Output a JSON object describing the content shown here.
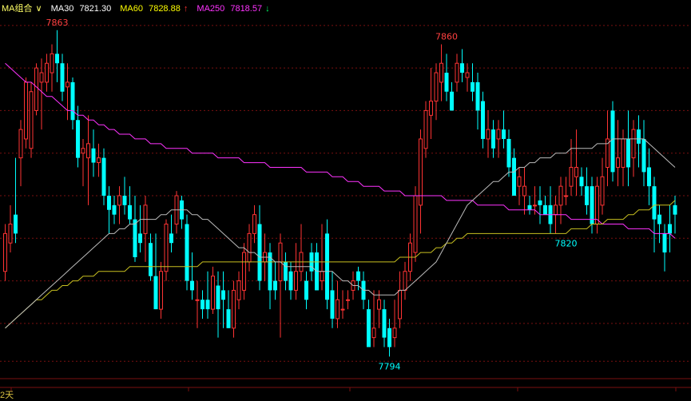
{
  "legend": {
    "group_label": "MA组合",
    "group_arrow": "∨",
    "ma30": {
      "label": "MA30",
      "value": "7821.30",
      "color": "#ffffff"
    },
    "ma60": {
      "label": "MA60",
      "value": "7828.88",
      "arrow": "↑",
      "color": "#ffff00"
    },
    "ma250": {
      "label": "MA250",
      "value": "7818.57",
      "arrow": "↓",
      "color": "#ff33ff"
    }
  },
  "footer_text": "2天",
  "colors": {
    "up": "#ff3333",
    "down": "#00ffff",
    "grid": "#7a1010",
    "background": "#000000"
  },
  "chart_data": {
    "type": "candlestick",
    "ylim": [
      7790,
      7866
    ],
    "grid_levels": [
      7864,
      7855,
      7846,
      7837,
      7828,
      7819,
      7810,
      7801,
      7793
    ],
    "annotations": [
      {
        "text": "7863",
        "index": 10,
        "value": 7863,
        "color": "#ff4040"
      },
      {
        "text": "7860",
        "index": 85,
        "value": 7860,
        "color": "#ff4040"
      },
      {
        "text": "7820",
        "index": 108,
        "value": 7820,
        "color": "#00ffff"
      },
      {
        "text": "7794",
        "index": 74,
        "value": 7794,
        "color": "#00ffff"
      }
    ],
    "candles": [
      [
        7812,
        7820,
        7810,
        7822
      ],
      [
        7818,
        7822,
        7816,
        7826
      ],
      [
        7824,
        7820,
        7818,
        7836
      ],
      [
        7836,
        7842,
        7830,
        7844
      ],
      [
        7840,
        7852,
        7838,
        7853
      ],
      [
        7838,
        7850,
        7836,
        7852
      ],
      [
        7846,
        7855,
        7845,
        7856
      ],
      [
        7852,
        7854,
        7842,
        7857
      ],
      [
        7852,
        7856,
        7850,
        7858
      ],
      [
        7854,
        7858,
        7850,
        7860
      ],
      [
        7858,
        7856,
        7852,
        7863
      ],
      [
        7856,
        7850,
        7848,
        7858
      ],
      [
        7851,
        7852,
        7844,
        7856
      ],
      [
        7852,
        7844,
        7842,
        7853
      ],
      [
        7844,
        7836,
        7834,
        7847
      ],
      [
        7837,
        7838,
        7830,
        7840
      ],
      [
        7836,
        7839,
        7826,
        7845
      ],
      [
        7838,
        7835,
        7832,
        7842
      ],
      [
        7835,
        7836,
        7832,
        7839
      ],
      [
        7836,
        7828,
        7826,
        7838
      ],
      [
        7828,
        7825,
        7820,
        7830
      ],
      [
        7826,
        7824,
        7822,
        7828
      ],
      [
        7826,
        7828,
        7822,
        7830
      ],
      [
        7828,
        7826,
        7824,
        7832
      ],
      [
        7826,
        7823,
        7822,
        7830
      ],
      [
        7823,
        7815,
        7814,
        7828
      ],
      [
        7820,
        7818,
        7816,
        7826
      ],
      [
        7820,
        7826,
        7814,
        7828
      ],
      [
        7818,
        7811,
        7810,
        7820
      ],
      [
        7811,
        7804,
        7804,
        7820
      ],
      [
        7804,
        7812,
        7802,
        7814
      ],
      [
        7812,
        7822,
        7810,
        7823
      ],
      [
        7820,
        7818,
        7816,
        7824
      ],
      [
        7822,
        7828,
        7820,
        7829
      ],
      [
        7827,
        7823,
        7821,
        7828
      ],
      [
        7822,
        7810,
        7808,
        7824
      ],
      [
        7810,
        7808,
        7806,
        7816
      ],
      [
        7806,
        7806,
        7800,
        7810
      ],
      [
        7806,
        7804,
        7802,
        7808
      ],
      [
        7806,
        7804,
        7802,
        7812
      ],
      [
        7804,
        7811,
        7803,
        7813
      ],
      [
        7809,
        7804,
        7798,
        7812
      ],
      [
        7808,
        7806,
        7800,
        7812
      ],
      [
        7804,
        7800,
        7800,
        7808
      ],
      [
        7800,
        7808,
        7798,
        7810
      ],
      [
        7806,
        7810,
        7804,
        7812
      ],
      [
        7808,
        7816,
        7806,
        7818
      ],
      [
        7814,
        7820,
        7812,
        7822
      ],
      [
        7820,
        7824,
        7818,
        7826
      ],
      [
        7822,
        7810,
        7808,
        7826
      ],
      [
        7814,
        7816,
        7810,
        7820
      ],
      [
        7816,
        7808,
        7804,
        7818
      ],
      [
        7810,
        7808,
        7806,
        7814
      ],
      [
        7810,
        7818,
        7798,
        7820
      ],
      [
        7814,
        7810,
        7808,
        7816
      ],
      [
        7812,
        7808,
        7806,
        7814
      ],
      [
        7808,
        7812,
        7806,
        7818
      ],
      [
        7812,
        7816,
        7810,
        7822
      ],
      [
        7810,
        7806,
        7804,
        7812
      ],
      [
        7816,
        7812,
        7810,
        7818
      ],
      [
        7816,
        7808,
        7808,
        7818
      ],
      [
        7810,
        7812,
        7808,
        7822
      ],
      [
        7820,
        7806,
        7804,
        7823
      ],
      [
        7808,
        7802,
        7800,
        7812
      ],
      [
        7802,
        7806,
        7800,
        7810
      ],
      [
        7804,
        7804,
        7802,
        7808
      ],
      [
        7806,
        7806,
        7804,
        7808
      ],
      [
        7808,
        7810,
        7806,
        7812
      ],
      [
        7812,
        7810,
        7808,
        7813
      ],
      [
        7810,
        7806,
        7804,
        7812
      ],
      [
        7804,
        7796,
        7796,
        7806
      ],
      [
        7798,
        7800,
        7796,
        7808
      ],
      [
        7804,
        7806,
        7800,
        7808
      ],
      [
        7804,
        7798,
        7796,
        7806
      ],
      [
        7800,
        7796,
        7794,
        7802
      ],
      [
        7798,
        7800,
        7796,
        7806
      ],
      [
        7802,
        7808,
        7800,
        7812
      ],
      [
        7808,
        7812,
        7806,
        7814
      ],
      [
        7812,
        7818,
        7810,
        7820
      ],
      [
        7816,
        7828,
        7814,
        7830
      ],
      [
        7826,
        7840,
        7820,
        7842
      ],
      [
        7838,
        7846,
        7836,
        7848
      ],
      [
        7845,
        7848,
        7840,
        7855
      ],
      [
        7848,
        7854,
        7844,
        7856
      ],
      [
        7852,
        7856,
        7848,
        7860
      ],
      [
        7854,
        7850,
        7848,
        7858
      ],
      [
        7850,
        7846,
        7846,
        7852
      ],
      [
        7852,
        7856,
        7850,
        7858
      ],
      [
        7856,
        7854,
        7852,
        7859
      ],
      [
        7853,
        7854,
        7850,
        7856
      ],
      [
        7852,
        7850,
        7848,
        7856
      ],
      [
        7852,
        7846,
        7842,
        7854
      ],
      [
        7848,
        7840,
        7838,
        7850
      ],
      [
        7840,
        7842,
        7836,
        7846
      ],
      [
        7842,
        7838,
        7836,
        7844
      ],
      [
        7840,
        7842,
        7836,
        7844
      ],
      [
        7842,
        7840,
        7838,
        7846
      ],
      [
        7840,
        7834,
        7832,
        7842
      ],
      [
        7836,
        7828,
        7828,
        7838
      ],
      [
        7830,
        7832,
        7826,
        7834
      ],
      [
        7828,
        7830,
        7824,
        7834
      ],
      [
        7826,
        7825,
        7824,
        7828
      ],
      [
        7826,
        7826,
        7824,
        7830
      ],
      [
        7827,
        7826,
        7822,
        7830
      ],
      [
        7826,
        7824,
        7824,
        7828
      ],
      [
        7826,
        7822,
        7820,
        7830
      ],
      [
        7824,
        7826,
        7820,
        7828
      ],
      [
        7826,
        7830,
        7822,
        7832
      ],
      [
        7828,
        7828,
        7826,
        7832
      ],
      [
        7830,
        7834,
        7828,
        7840
      ],
      [
        7832,
        7834,
        7828,
        7842
      ],
      [
        7832,
        7830,
        7828,
        7834
      ],
      [
        7830,
        7826,
        7824,
        7834
      ],
      [
        7830,
        7822,
        7820,
        7832
      ],
      [
        7822,
        7830,
        7820,
        7832
      ],
      [
        7826,
        7832,
        7824,
        7836
      ],
      [
        7834,
        7840,
        7830,
        7846
      ],
      [
        7846,
        7833,
        7831,
        7848
      ],
      [
        7834,
        7836,
        7830,
        7844
      ],
      [
        7834,
        7840,
        7830,
        7842
      ],
      [
        7840,
        7834,
        7830,
        7846
      ],
      [
        7836,
        7842,
        7832,
        7844
      ],
      [
        7842,
        7839,
        7834,
        7845
      ],
      [
        7840,
        7833,
        7830,
        7844
      ],
      [
        7834,
        7830,
        7826,
        7838
      ],
      [
        7830,
        7823,
        7816,
        7832
      ],
      [
        7824,
        7822,
        7818,
        7826
      ],
      [
        7820,
        7816,
        7812,
        7822
      ],
      [
        7822,
        7820,
        7816,
        7826
      ],
      [
        7826,
        7824,
        7820,
        7828
      ]
    ],
    "ma30": [
      7800,
      7801,
      7802,
      7803,
      7804,
      7805,
      7806,
      7807,
      7808,
      7809,
      7810,
      7811,
      7812,
      7813,
      7814,
      7815,
      7816,
      7817,
      7818,
      7819,
      7820,
      7820,
      7821,
      7821,
      7822,
      7822,
      7823,
      7823,
      7823,
      7823,
      7824,
      7824,
      7825,
      7825,
      7825,
      7825,
      7824,
      7824,
      7823,
      7823,
      7822,
      7821,
      7820,
      7819,
      7818,
      7817,
      7817,
      7816,
      7816,
      7815,
      7815,
      7815,
      7814,
      7814,
      7813,
      7813,
      7813,
      7813,
      7813,
      7813,
      7812,
      7812,
      7812,
      7812,
      7811,
      7810,
      7810,
      7809,
      7809,
      7808,
      7808,
      7807,
      7807,
      7807,
      7807,
      7807,
      7808,
      7808,
      7809,
      7810,
      7811,
      7812,
      7813,
      7814,
      7816,
      7818,
      7820,
      7822,
      7824,
      7826,
      7827,
      7828,
      7829,
      7830,
      7831,
      7831,
      7832,
      7833,
      7833,
      7834,
      7834,
      7835,
      7835,
      7836,
      7836,
      7836,
      7837,
      7837,
      7837,
      7838,
      7838,
      7838,
      7838,
      7838,
      7839,
      7839,
      7839,
      7840,
      7840,
      7840,
      7840,
      7840,
      7840,
      7840,
      7839,
      7838,
      7837,
      7836,
      7835,
      7834
    ],
    "ma60": [
      7800,
      7801,
      7802,
      7803,
      7804,
      7805,
      7806,
      7806,
      7807,
      7808,
      7808,
      7809,
      7809,
      7810,
      7810,
      7811,
      7811,
      7811,
      7812,
      7812,
      7812,
      7812,
      7812,
      7812,
      7813,
      7813,
      7813,
      7813,
      7813,
      7813,
      7813,
      7813,
      7813,
      7813,
      7813,
      7813,
      7813,
      7813,
      7814,
      7814,
      7814,
      7814,
      7814,
      7814,
      7814,
      7814,
      7814,
      7814,
      7814,
      7814,
      7814,
      7814,
      7814,
      7814,
      7814,
      7814,
      7814,
      7814,
      7814,
      7814,
      7814,
      7814,
      7814,
      7814,
      7814,
      7814,
      7814,
      7814,
      7814,
      7814,
      7814,
      7814,
      7814,
      7814,
      7814,
      7814,
      7815,
      7815,
      7815,
      7815,
      7816,
      7816,
      7816,
      7817,
      7817,
      7818,
      7818,
      7819,
      7819,
      7820,
      7820,
      7820,
      7820,
      7820,
      7820,
      7820,
      7820,
      7820,
      7820,
      7820,
      7820,
      7820,
      7820,
      7820,
      7820,
      7820,
      7820,
      7820,
      7820,
      7821,
      7821,
      7821,
      7821,
      7822,
      7822,
      7822,
      7823,
      7823,
      7823,
      7823,
      7824,
      7824,
      7825,
      7825,
      7825,
      7826,
      7826,
      7826,
      7826,
      7827
    ],
    "ma250": [
      7856,
      7855,
      7854,
      7853,
      7852,
      7852,
      7851,
      7850,
      7849,
      7849,
      7848,
      7847,
      7846,
      7846,
      7845,
      7845,
      7844,
      7844,
      7843,
      7843,
      7842,
      7842,
      7841,
      7841,
      7841,
      7840,
      7840,
      7840,
      7839,
      7839,
      7839,
      7838,
      7838,
      7838,
      7838,
      7838,
      7837,
      7837,
      7837,
      7837,
      7837,
      7836,
      7836,
      7836,
      7836,
      7836,
      7835,
      7835,
      7835,
      7835,
      7835,
      7834,
      7834,
      7834,
      7834,
      7834,
      7834,
      7834,
      7833,
      7833,
      7833,
      7833,
      7833,
      7832,
      7832,
      7832,
      7831,
      7831,
      7831,
      7830,
      7830,
      7830,
      7830,
      7829,
      7829,
      7829,
      7829,
      7828,
      7828,
      7828,
      7828,
      7828,
      7828,
      7828,
      7828,
      7827,
      7827,
      7827,
      7827,
      7827,
      7827,
      7826,
      7826,
      7826,
      7826,
      7826,
      7826,
      7825,
      7825,
      7825,
      7825,
      7825,
      7825,
      7824,
      7824,
      7824,
      7824,
      7824,
      7824,
      7823,
      7823,
      7823,
      7823,
      7823,
      7823,
      7822,
      7822,
      7822,
      7822,
      7822,
      7821,
      7821,
      7821,
      7821,
      7821,
      7820,
      7820,
      7820,
      7820,
      7819
    ]
  }
}
